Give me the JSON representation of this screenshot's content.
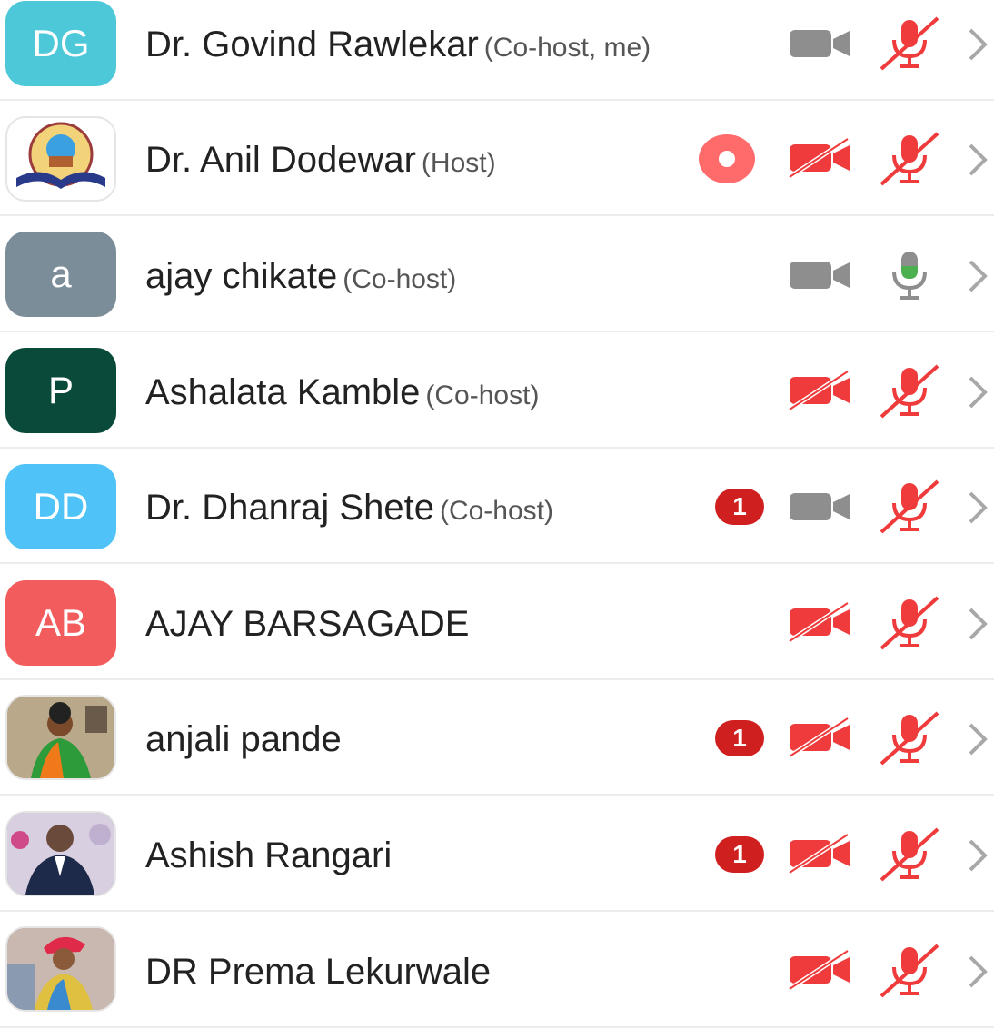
{
  "participants": [
    {
      "name": "Dr. Govind Rawlekar",
      "role": "(Co-host, me)",
      "initials": "DG",
      "avatar_color": "#4dc8d9",
      "avatar_type": "initials",
      "video": "off-gray",
      "mic": "muted",
      "badge": "",
      "recording": false
    },
    {
      "name": "Dr. Anil Dodewar",
      "role": "(Host)",
      "initials": "",
      "avatar_color": "#ffffff",
      "avatar_type": "logo",
      "video": "off-red",
      "mic": "muted",
      "badge": "",
      "recording": true
    },
    {
      "name": "ajay chikate",
      "role": "(Co-host)",
      "initials": "a",
      "avatar_color": "#7b8d99",
      "avatar_type": "initials",
      "video": "off-gray",
      "mic": "active",
      "badge": "",
      "recording": false
    },
    {
      "name": "Ashalata Kamble",
      "role": "(Co-host)",
      "initials": "P",
      "avatar_color": "#0a4a3a",
      "avatar_type": "initials",
      "video": "off-red",
      "mic": "muted",
      "badge": "",
      "recording": false
    },
    {
      "name": "Dr. Dhanraj Shete",
      "role": "(Co-host)",
      "initials": "DD",
      "avatar_color": "#4fc3f7",
      "avatar_type": "initials",
      "video": "off-gray",
      "mic": "muted",
      "badge": "1",
      "recording": false
    },
    {
      "name": "AJAY BARSAGADE",
      "role": "",
      "initials": "AB",
      "avatar_color": "#f25c5c",
      "avatar_type": "initials",
      "video": "off-red",
      "mic": "muted",
      "badge": "",
      "recording": false
    },
    {
      "name": "anjali pande",
      "role": "",
      "initials": "",
      "avatar_color": "#a08a6a",
      "avatar_type": "photo",
      "video": "off-red",
      "mic": "muted",
      "badge": "1",
      "recording": false
    },
    {
      "name": "Ashish Rangari",
      "role": "",
      "initials": "",
      "avatar_color": "#8a7a9a",
      "avatar_type": "photo",
      "video": "off-red",
      "mic": "muted",
      "badge": "1",
      "recording": false
    },
    {
      "name": "DR Prema Lekurwale",
      "role": "",
      "initials": "",
      "avatar_color": "#c08080",
      "avatar_type": "photo",
      "video": "off-red",
      "mic": "muted",
      "badge": "",
      "recording": false
    }
  ],
  "colors": {
    "muted_red": "#ef3b3b",
    "video_gray": "#8e8e8e",
    "mic_green": "#4caf50",
    "chevron": "#a8a8a8",
    "badge_red": "#d01f1f"
  },
  "icons": {
    "video": "video-camera-icon",
    "mic": "microphone-icon",
    "chevron": "chevron-right-icon",
    "recording": "recording-icon"
  }
}
